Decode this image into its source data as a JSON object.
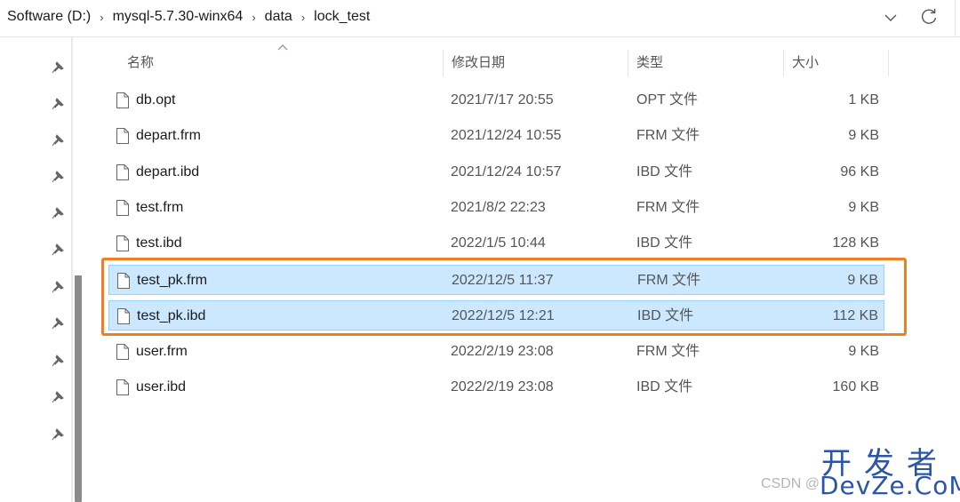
{
  "breadcrumb": [
    "Software (D:)",
    "mysql-5.7.30-winx64",
    "data",
    "lock_test"
  ],
  "breadcrumb_sep": "›",
  "icons": {
    "dropdown": "chevron-down-icon",
    "refresh": "refresh-icon",
    "pin": "pin-icon",
    "file": "file-icon",
    "sort": "sort-up-icon"
  },
  "columns": {
    "name": "名称",
    "date": "修改日期",
    "type": "类型",
    "size": "大小"
  },
  "files": [
    {
      "name": "db.opt",
      "date": "2021/7/17 20:55",
      "type": "OPT 文件",
      "size": "1 KB",
      "selected": false
    },
    {
      "name": "depart.frm",
      "date": "2021/12/24 10:55",
      "type": "FRM 文件",
      "size": "9 KB",
      "selected": false
    },
    {
      "name": "depart.ibd",
      "date": "2021/12/24 10:57",
      "type": "IBD 文件",
      "size": "96 KB",
      "selected": false
    },
    {
      "name": "test.frm",
      "date": "2021/8/2 22:23",
      "type": "FRM 文件",
      "size": "9 KB",
      "selected": false
    },
    {
      "name": "test.ibd",
      "date": "2022/1/5 10:44",
      "type": "IBD 文件",
      "size": "128 KB",
      "selected": false
    },
    {
      "name": "test_pk.frm",
      "date": "2022/12/5 11:37",
      "type": "FRM 文件",
      "size": "9 KB",
      "selected": true
    },
    {
      "name": "test_pk.ibd",
      "date": "2022/12/5 12:21",
      "type": "IBD 文件",
      "size": "112 KB",
      "selected": true
    },
    {
      "name": "user.frm",
      "date": "2022/2/19 23:08",
      "type": "FRM 文件",
      "size": "9 KB",
      "selected": false
    },
    {
      "name": "user.ibd",
      "date": "2022/2/19 23:08",
      "type": "IBD 文件",
      "size": "160 KB",
      "selected": false
    }
  ],
  "colors": {
    "selection": "#cce8ff",
    "selection_border": "#99d1ff",
    "highlight": "#f07f22",
    "watermark": "#2b55a6"
  },
  "watermark": {
    "csdn": "CSDN @",
    "cn": "开发者",
    "en": "DevZe.CoM"
  }
}
